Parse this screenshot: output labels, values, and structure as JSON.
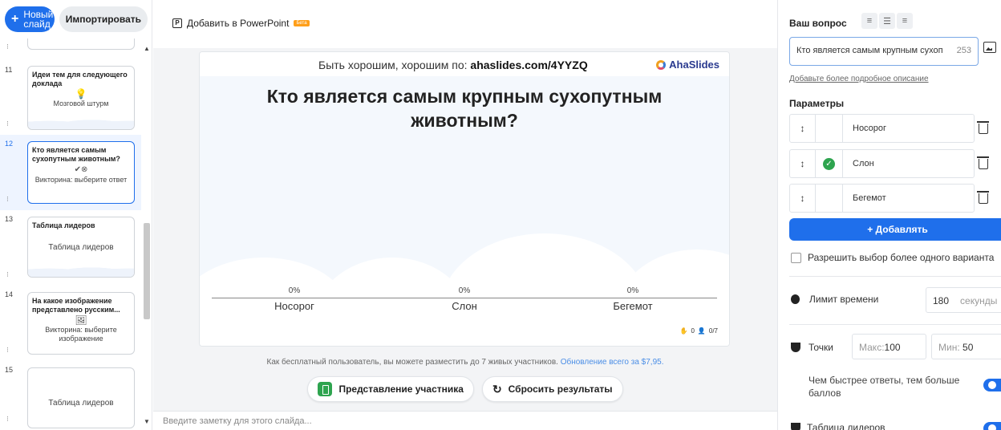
{
  "sidebar": {
    "new_slide": [
      "Новый",
      "слайд"
    ],
    "import": "Импортировать",
    "slides": [
      {
        "num": "11",
        "title": "Идеи тем для следующего доклада",
        "subtitle": "Мозговой штурм"
      },
      {
        "num": "12",
        "title": "Кто является самым сухопутным животным?",
        "subtitle": "Викторина: выберите ответ",
        "active": true
      },
      {
        "num": "13",
        "title": "Таблица лидеров",
        "subtitle": "Таблица лидеров"
      },
      {
        "num": "14",
        "title": "На какое изображение представлено русским...",
        "subtitle": "Викторина: выберите изображение"
      },
      {
        "num": "15",
        "title": "",
        "subtitle": "Таблица лидеров"
      }
    ]
  },
  "toolbar": {
    "add_ppt": "Добавить в PowerPoint",
    "beta": "Бета"
  },
  "canvas": {
    "join_prefix": "Быть хорошим, хорошим по:",
    "join_url": "ahaslides.com/4YYZQ",
    "brand": "AhaSlides",
    "question": "Кто является самым крупным сухопутным животным?",
    "options": [
      {
        "label": "Носорог",
        "pct": "0%"
      },
      {
        "label": "Слон",
        "pct": "0%"
      },
      {
        "label": "Бегемот",
        "pct": "0%"
      }
    ],
    "reactions": "0",
    "participants": "0/7"
  },
  "free_note": {
    "text": "Как бесплатный пользователь, вы можете разместить до 7 живых участников.",
    "link": "Обновление всего за $7,95."
  },
  "buttons": {
    "participant_view": "Представление участника",
    "reset_results": "Сбросить результаты"
  },
  "notes": {
    "placeholder": "Введите заметку для этого слайда..."
  },
  "panel": {
    "your_question": "Ваш вопрос",
    "question_value": "Кто является самым крупным сухоп",
    "char_count": "253",
    "add_description": "Добавьте более подробное описание",
    "parameters": "Параметры",
    "options": [
      {
        "label": "Носорог",
        "correct": false
      },
      {
        "label": "Слон",
        "correct": true
      },
      {
        "label": "Бегемот",
        "correct": false
      }
    ],
    "add_button": "+ Добавлять",
    "allow_multiple": "Разрешить выбор более одного варианта",
    "time_limit": "Лимит времени",
    "time_value": "180",
    "time_unit": "секунды",
    "points": "Точки",
    "max_label": "Макс:",
    "max_value": "100",
    "min_label": "Мин:",
    "min_value": "50",
    "faster_answers": "Чем быстрее ответы, тем больше баллов",
    "leaderboard": "Таблица лидеров"
  }
}
